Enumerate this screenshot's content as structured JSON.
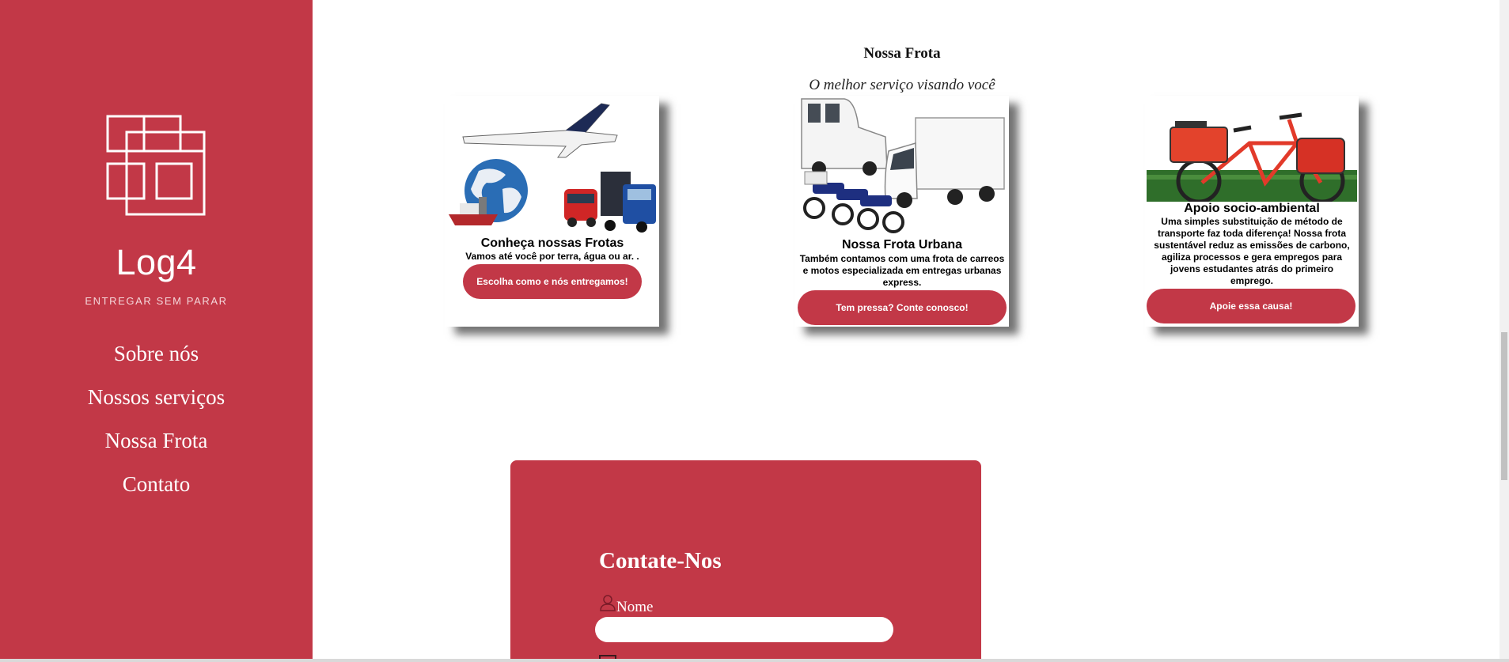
{
  "sidebar": {
    "logo_icon": "overlapping-squares-logo",
    "brand": "Log4",
    "tagline": "ENTREGAR SEM PARAR",
    "nav": [
      "Sobre nós",
      "Nossos serviços",
      "Nossa Frota",
      "Contato"
    ]
  },
  "fleet": {
    "title": "Nossa Frota",
    "subtitle": "O melhor serviço visando você",
    "cards": [
      {
        "title": "Conheça nossas Frotas",
        "text": "Vamos até você por terra, água ou ar. .",
        "button": "Escolha como e nós entregamos!",
        "image": "airplane-globe-ship-vans-truck"
      },
      {
        "title": "Nossa Frota Urbana",
        "text": "Também contamos com uma frota de carreos e motos especializada em entregas urbanas express.",
        "button": "Tem pressa? Conte conosco!",
        "image": "vans-truck-motorcycles"
      },
      {
        "title": "Apoio socio-ambiental",
        "text": "Uma simples substituição de método de transporte faz toda diferença! Nossa frota sustentável reduz as emissões de carbono, agiliza processos e gera empregos para jovens estudantes atrás do primeiro emprego.",
        "button": "Apoie essa causa!",
        "image": "red-delivery-bicycle"
      }
    ]
  },
  "contact": {
    "title": "Contate-Nos",
    "name_label": "Nome",
    "name_value": "",
    "name_placeholder": ""
  },
  "colors": {
    "brand_red": "#c23847",
    "white": "#ffffff"
  }
}
